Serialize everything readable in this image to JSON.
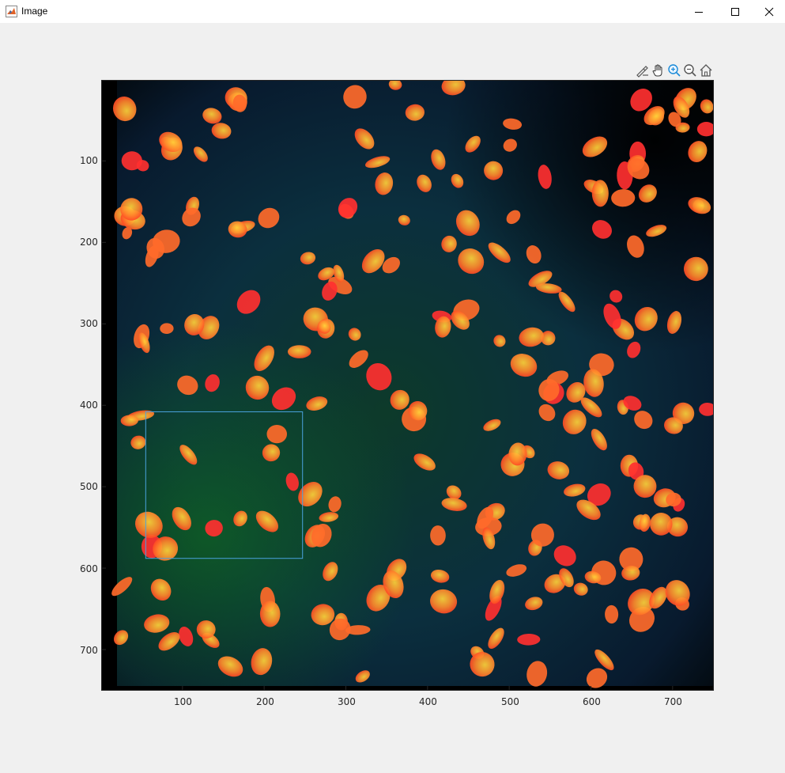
{
  "window": {
    "title": "Image",
    "icon": "matlab-icon",
    "controls": [
      "minimize-icon",
      "maximize-icon",
      "close-icon"
    ]
  },
  "toolbar": {
    "buttons": [
      "brush-icon",
      "pan-hand-icon",
      "zoom-in-icon",
      "zoom-out-icon",
      "home-icon"
    ]
  },
  "axes": {
    "x_ticks": [
      "100",
      "200",
      "300",
      "400",
      "500",
      "600",
      "700"
    ],
    "y_ticks": [
      "100",
      "200",
      "300",
      "400",
      "500",
      "600",
      "700"
    ],
    "x_range": [
      0.5,
      750.5
    ],
    "y_range": [
      0.5,
      750.5
    ],
    "y_direction": "reversed (image)"
  },
  "image": {
    "description_type": "fluorescence overlay",
    "background_colors": [
      "#0b1a3a",
      "#0f3a1a",
      "#000000"
    ],
    "overlay_colors": [
      "#ff5a2a",
      "#ff8c2a",
      "#ffe02a"
    ]
  },
  "selection_rect": {
    "x_range": [
      55,
      247
    ],
    "y_range": [
      408,
      588
    ],
    "color": "#4aa3df"
  }
}
